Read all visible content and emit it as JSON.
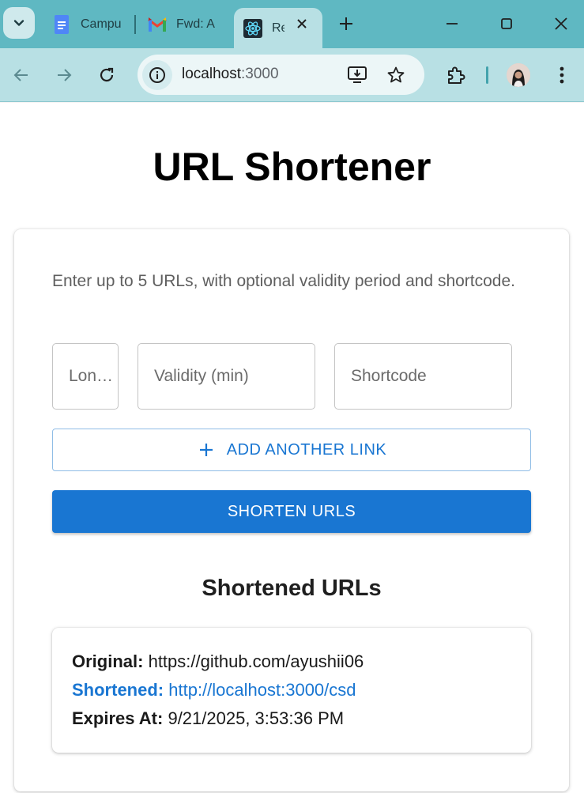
{
  "browser": {
    "tabs": [
      {
        "title": "Campus"
      },
      {
        "title": "Fwd: A"
      },
      {
        "title": "React App"
      }
    ],
    "url_host": "localhost",
    "url_port": ":3000"
  },
  "app": {
    "title": "URL Shortener",
    "intro": "Enter up to 5 URLs, with optional validity period and shortcode.",
    "fields": {
      "long_url_placeholder": "Long URL",
      "validity_placeholder": "Validity (min)",
      "shortcode_placeholder": "Shortcode"
    },
    "add_button_label": "ADD ANOTHER LINK",
    "shorten_button_label": "SHORTEN URLS",
    "results_title": "Shortened URLs",
    "results": [
      {
        "original_label": "Original:",
        "original": "https://github.com/ayushii06",
        "shortened_label": "Shortened:",
        "shortened": "http://localhost:3000/csd",
        "expires_label": "Expires At:",
        "expires": "9/21/2025, 3:53:36 PM"
      }
    ]
  },
  "colors": {
    "primary": "#1976d2",
    "tabbar": "#5fb8c2",
    "toolbar": "#b8e0e4"
  }
}
